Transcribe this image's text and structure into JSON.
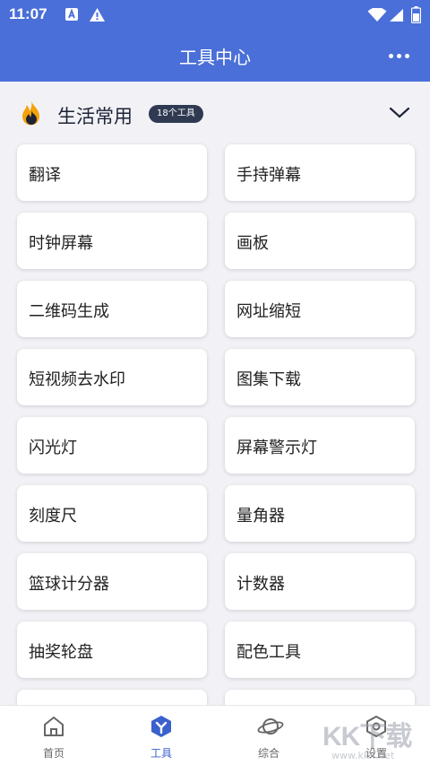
{
  "status": {
    "time": "11:07",
    "icons": [
      "a-notification-icon",
      "warning-icon",
      "wifi-icon",
      "signal-icon",
      "battery-icon"
    ]
  },
  "appbar": {
    "title": "工具中心",
    "more_icon": "more-dots-icon"
  },
  "section": {
    "icon": "fire-icon",
    "title": "生活常用",
    "count": "18个工具",
    "collapse_icon": "chevron-down-icon"
  },
  "tools": [
    {
      "label": "翻译"
    },
    {
      "label": "手持弹幕"
    },
    {
      "label": "时钟屏幕"
    },
    {
      "label": "画板"
    },
    {
      "label": "二维码生成"
    },
    {
      "label": "网址缩短"
    },
    {
      "label": "短视频去水印"
    },
    {
      "label": "图集下载"
    },
    {
      "label": "闪光灯"
    },
    {
      "label": "屏幕警示灯"
    },
    {
      "label": "刻度尺"
    },
    {
      "label": "量角器"
    },
    {
      "label": "篮球计分器"
    },
    {
      "label": "计数器"
    },
    {
      "label": "抽奖轮盘"
    },
    {
      "label": "配色工具"
    }
  ],
  "tabbar": {
    "items": [
      {
        "label": "首页",
        "icon": "home-icon"
      },
      {
        "label": "工具",
        "icon": "tools-icon",
        "active": true
      },
      {
        "label": "综合",
        "icon": "planet-icon"
      },
      {
        "label": "设置",
        "icon": "settings-icon"
      }
    ]
  },
  "watermark": {
    "text": "KK下载",
    "url": "www.kkx.net"
  },
  "colors": {
    "primary": "#4a6fd8",
    "active_tab": "#3a61cc",
    "badge": "#2f3a52",
    "background": "#f2f2f6"
  }
}
